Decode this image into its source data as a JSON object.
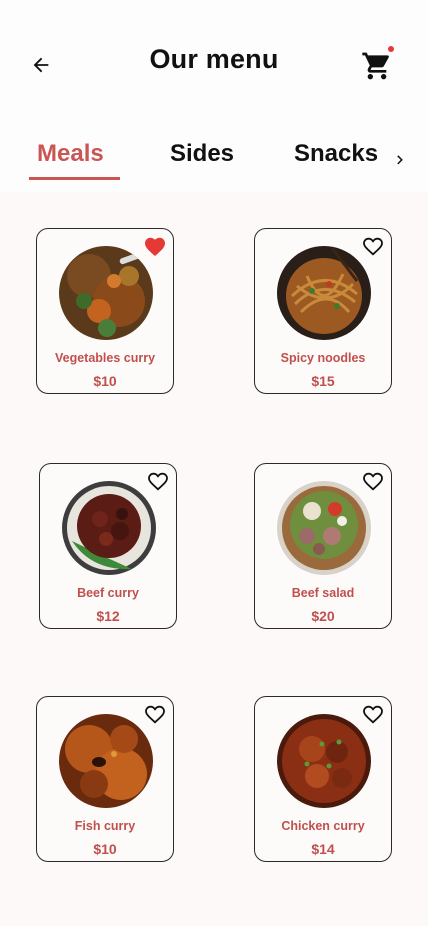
{
  "header": {
    "title": "Our menu",
    "back_icon": "arrow-left-icon",
    "cart_icon": "shopping-cart-icon",
    "cart_badge_color": "#e53935"
  },
  "tabs": [
    {
      "label": "Meals",
      "active": true
    },
    {
      "label": "Sides",
      "active": false
    },
    {
      "label": "Snacks",
      "active": false
    }
  ],
  "accent_color": "#c95555",
  "items": [
    {
      "name": "Vegetables curry",
      "price": "$10",
      "favorite": true
    },
    {
      "name": "Spicy noodles",
      "price": "$15",
      "favorite": false
    },
    {
      "name": "Beef curry",
      "price": "$12",
      "favorite": false
    },
    {
      "name": "Beef salad",
      "price": "$20",
      "favorite": false
    },
    {
      "name": "Fish curry",
      "price": "$10",
      "favorite": false
    },
    {
      "name": "Chicken curry",
      "price": "$14",
      "favorite": false
    }
  ]
}
